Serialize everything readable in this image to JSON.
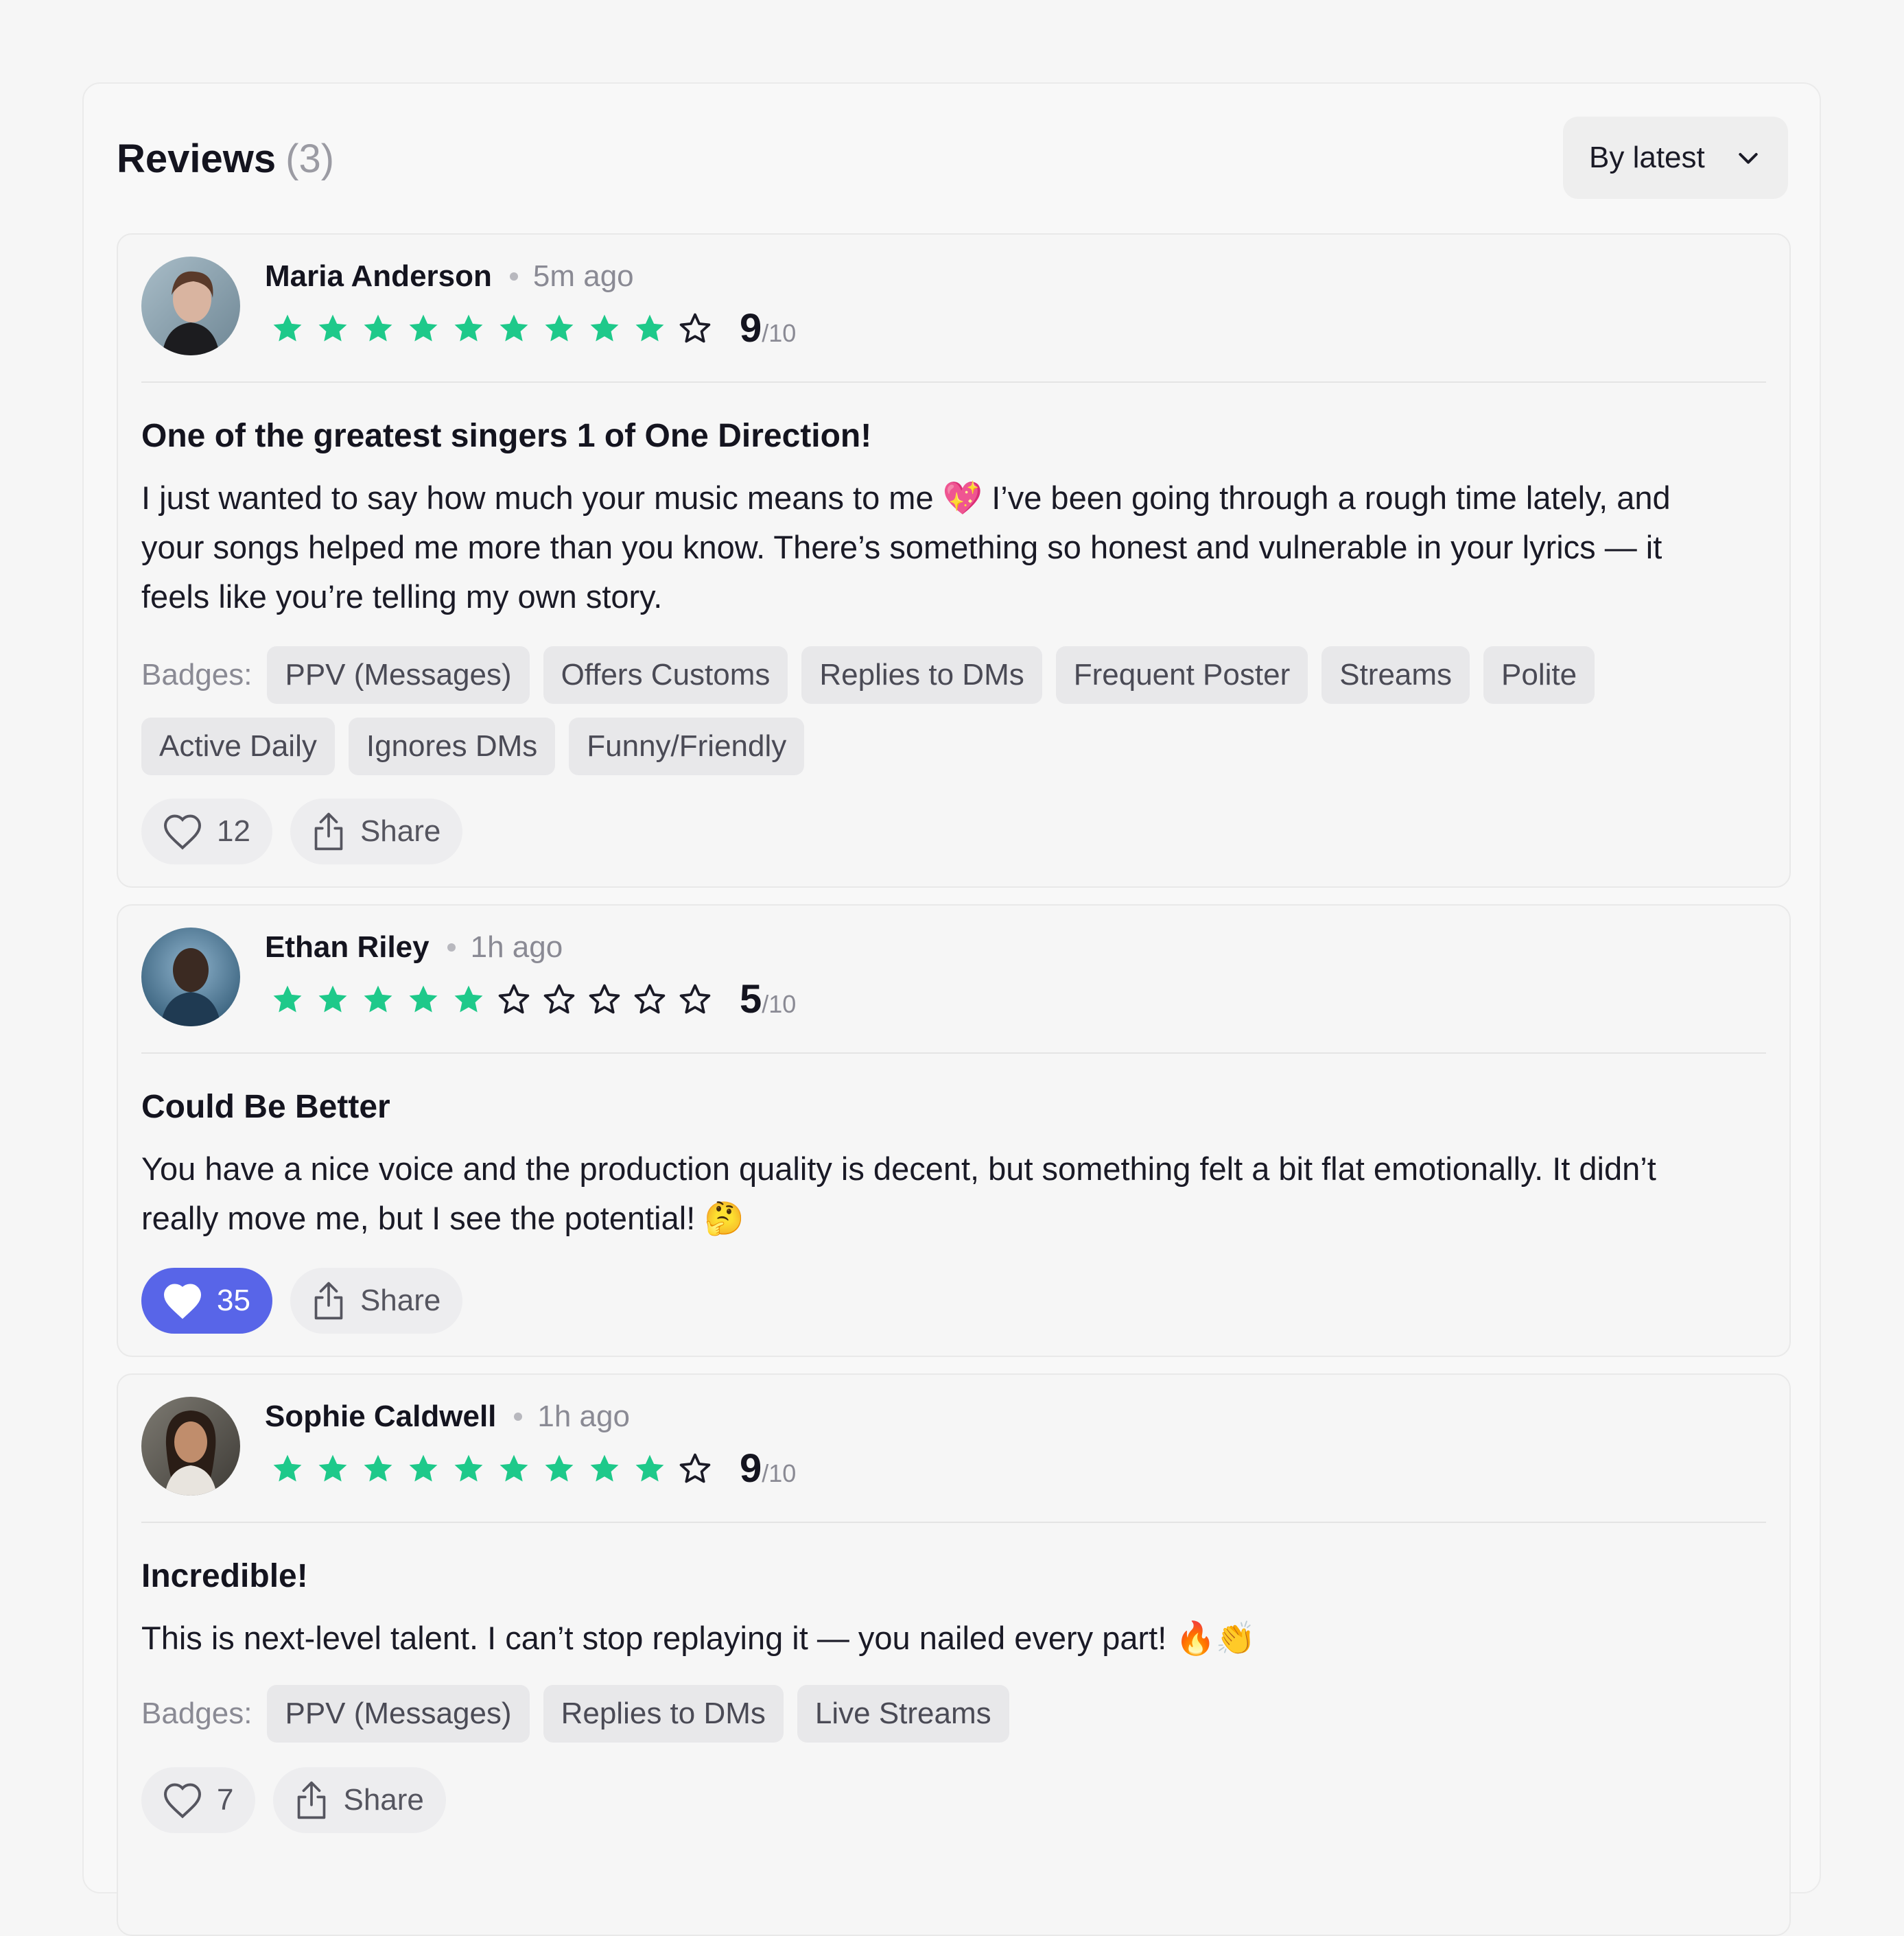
{
  "header": {
    "title": "Reviews",
    "count": "(3)",
    "sort_label": "By latest"
  },
  "colors": {
    "star_filled": "#1ec98a",
    "like_active": "#5865e8"
  },
  "reviews": [
    {
      "name": "Maria Anderson",
      "time": "5m ago",
      "rating": 9,
      "rating_display": "9",
      "rating_max": "/10",
      "title": "One of the greatest singers 1 of One Direction!",
      "body": "I just wanted to say how much your music means to me 💖 I’ve been going through a rough time lately, and your songs helped me more than you know. There’s something so honest and vulnerable in your lyrics — it feels like you’re telling my own story.",
      "badges_label": "Badges:",
      "badges": [
        "PPV (Messages)",
        "Offers Customs",
        "Replies to DMs",
        "Frequent Poster",
        "Streams",
        "Polite",
        "Active Daily",
        "Ignores DMs",
        "Funny/Friendly"
      ],
      "likes": "12",
      "liked": false,
      "share_label": "Share"
    },
    {
      "name": "Ethan Riley",
      "time": "1h ago",
      "rating": 5,
      "rating_display": "5",
      "rating_max": "/10",
      "title": "Could Be Better",
      "body": "You have a nice voice and the production quality is decent, but something felt a bit flat emotionally. It didn’t really move me, but I see the potential! 🤔",
      "badges_label": "",
      "badges": [],
      "likes": "35",
      "liked": true,
      "share_label": "Share"
    },
    {
      "name": "Sophie Caldwell",
      "time": "1h ago",
      "rating": 9,
      "rating_display": "9",
      "rating_max": "/10",
      "title": "Incredible!",
      "body": "This is next-level talent. I can’t stop replaying it — you nailed every part! 🔥👏",
      "badges_label": "Badges:",
      "badges": [
        "PPV (Messages)",
        "Replies to DMs",
        "Live Streams"
      ],
      "likes": "7",
      "liked": false,
      "share_label": "Share"
    }
  ]
}
